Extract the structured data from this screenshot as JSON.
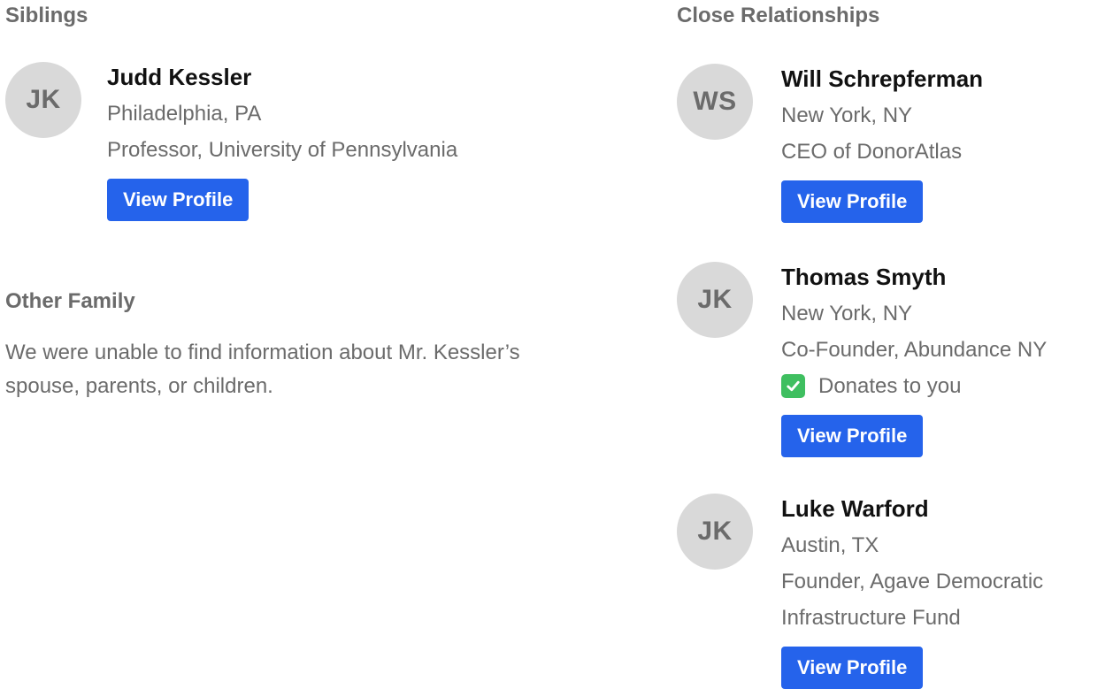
{
  "siblings": {
    "heading": "Siblings",
    "people": [
      {
        "initials": "JK",
        "name": "Judd Kessler",
        "location": "Philadelphia, PA",
        "role": "Professor, University of Pennsylvania",
        "button": "View Profile"
      }
    ]
  },
  "other_family": {
    "heading": "Other Family",
    "text": "We were unable to find information about Mr. Kessler’s spouse, parents, or children."
  },
  "close_relationships": {
    "heading": "Close Relationships",
    "people": [
      {
        "initials": "WS",
        "name": "Will Schrepferman",
        "location": "New York, NY",
        "role": "CEO of DonorAtlas",
        "button": "View Profile"
      },
      {
        "initials": "JK",
        "name": "Thomas Smyth",
        "location": "New York, NY",
        "role": "Co-Founder, Abundance NY",
        "donates_label": "Donates to you",
        "donates_icon": "check-icon",
        "button": "View Profile"
      },
      {
        "initials": "JK",
        "name": "Luke Warford",
        "location": "Austin, TX",
        "role_line1": "Founder, Agave Democratic",
        "role_line2": "Infrastructure Fund",
        "button": "View Profile"
      }
    ]
  },
  "colors": {
    "accent": "#2563eb",
    "avatar_bg": "#d9d9d9",
    "muted_text": "#6b6b6b",
    "check_green": "#3fbf60"
  }
}
